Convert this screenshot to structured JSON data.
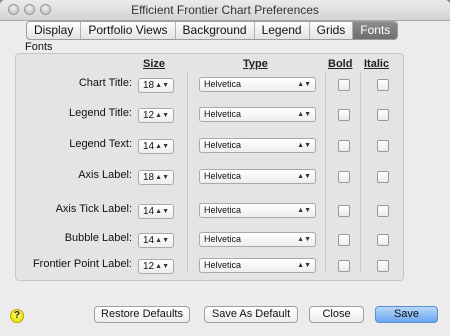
{
  "window": {
    "title": "Efficient Frontier Chart Preferences"
  },
  "tabs": [
    {
      "label": "Display",
      "active": false
    },
    {
      "label": "Portfolio Views",
      "active": false
    },
    {
      "label": "Background",
      "active": false
    },
    {
      "label": "Legend",
      "active": false
    },
    {
      "label": "Grids",
      "active": false
    },
    {
      "label": "Fonts",
      "active": true
    }
  ],
  "fonts_group": {
    "label": "Fonts",
    "headers": {
      "size": "Size",
      "type": "Type",
      "bold": "Bold",
      "italic": "Italic"
    },
    "rows": [
      {
        "label": "Chart Title:",
        "size": "18",
        "type": "Helvetica",
        "bold": false,
        "italic": false
      },
      {
        "label": "Legend Title:",
        "size": "12",
        "type": "Helvetica",
        "bold": false,
        "italic": false
      },
      {
        "label": "Legend Text:",
        "size": "14",
        "type": "Helvetica",
        "bold": false,
        "italic": false
      },
      {
        "label": "Axis Label:",
        "size": "18",
        "type": "Helvetica",
        "bold": false,
        "italic": false
      },
      {
        "label": "Axis Tick Label:",
        "size": "14",
        "type": "Helvetica",
        "bold": false,
        "italic": false
      },
      {
        "label": "Bubble Label:",
        "size": "14",
        "type": "Helvetica",
        "bold": false,
        "italic": false
      },
      {
        "label": "Frontier Point Label:",
        "size": "12",
        "type": "Helvetica",
        "bold": false,
        "italic": false
      }
    ]
  },
  "buttons": {
    "help": "?",
    "restore_defaults": "Restore Defaults",
    "save_as_default": "Save As Default",
    "close": "Close",
    "save": "Save"
  },
  "colors": {
    "primary_button": "#6aa6ef",
    "active_tab": "#7a7a7a",
    "help_button": "#f0e000"
  }
}
